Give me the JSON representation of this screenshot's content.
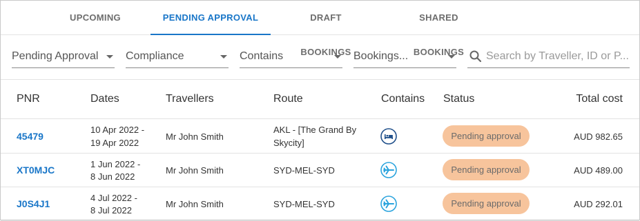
{
  "tabs": [
    {
      "label": "UPCOMING"
    },
    {
      "label": "PENDING APPROVAL",
      "active": true
    },
    {
      "label": "DRAFT BOOKINGS"
    },
    {
      "label": "SHARED BOOKINGS"
    }
  ],
  "filters": {
    "status": "Pending Approval",
    "compliance": "Compliance",
    "contains": "Contains",
    "bookings": "Bookings..."
  },
  "search": {
    "placeholder": "Search by Traveller, ID or P..."
  },
  "table": {
    "headers": {
      "pnr": "PNR",
      "dates": "Dates",
      "travellers": "Travellers",
      "route": "Route",
      "contains": "Contains",
      "status": "Status",
      "total": "Total cost"
    },
    "rows": [
      {
        "pnr": "45479",
        "date_from": "10 Apr 2022 -",
        "date_to": "19 Apr 2022",
        "traveller": "Mr John Smith",
        "route_line1": "AKL - [The Grand By",
        "route_line2": "Skycity]",
        "contains_icon": "hotel-bed-icon",
        "status": "Pending approval",
        "total": "AUD 982.65"
      },
      {
        "pnr": "XT0MJC",
        "date_from": "1 Jun 2022 -",
        "date_to": "8 Jun 2022",
        "traveller": "Mr John Smith",
        "route_line1": "SYD-MEL-SYD",
        "route_line2": "",
        "contains_icon": "flight-icon",
        "status": "Pending approval",
        "total": "AUD 489.00"
      },
      {
        "pnr": "J0S4J1",
        "date_from": "4 Jul 2022 -",
        "date_to": "8 Jul 2022",
        "traveller": "Mr John Smith",
        "route_line1": "SYD-MEL-SYD",
        "route_line2": "",
        "contains_icon": "flight-icon",
        "status": "Pending approval",
        "total": "AUD 292.01"
      }
    ]
  },
  "colors": {
    "accent": "#1976c8",
    "badge_bg": "#f7c49c",
    "badge_text": "#6a6a6a",
    "flight_icon": "#29a3dd",
    "hotel_icon": "#1f4f8a"
  }
}
